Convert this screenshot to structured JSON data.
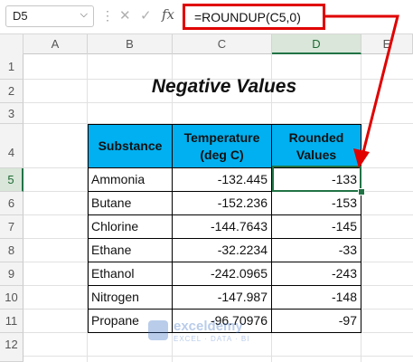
{
  "formula_bar": {
    "name_box": "D5",
    "name_box_arrow": "⌵",
    "dots": "⋮",
    "cancel_icon": "✕",
    "enter_icon": "✓",
    "fx_label": "fx",
    "formula": "=ROUNDUP(C5,0)"
  },
  "columns": [
    "A",
    "B",
    "C",
    "D",
    "E"
  ],
  "selected_column": "D",
  "rows": [
    "1",
    "2",
    "3",
    "4",
    "5",
    "6",
    "7",
    "8",
    "9",
    "10",
    "11",
    "12"
  ],
  "selected_row": "5",
  "sheet": {
    "title": "Negative Values",
    "headers": {
      "substance": "Substance",
      "temperature": "Temperature (deg C)",
      "rounded": "Rounded Values"
    },
    "data": [
      {
        "substance": "Ammonia",
        "temperature": "-132.445",
        "rounded": "-133"
      },
      {
        "substance": "Butane",
        "temperature": "-152.236",
        "rounded": "-153"
      },
      {
        "substance": "Chlorine",
        "temperature": "-144.7643",
        "rounded": "-145"
      },
      {
        "substance": "Ethane",
        "temperature": "-32.2234",
        "rounded": "-33"
      },
      {
        "substance": "Ethanol",
        "temperature": "-242.0965",
        "rounded": "-243"
      },
      {
        "substance": "Nitrogen",
        "temperature": "-147.987",
        "rounded": "-148"
      },
      {
        "substance": "Propane",
        "temperature": "-96.70976",
        "rounded": "-97"
      }
    ]
  },
  "watermark": {
    "name": "exceldemy",
    "tagline": "EXCEL · DATA · BI"
  },
  "colors": {
    "header_fill": "#00b0f0",
    "annotation_red": "#e00000",
    "selection_green": "#217346"
  }
}
